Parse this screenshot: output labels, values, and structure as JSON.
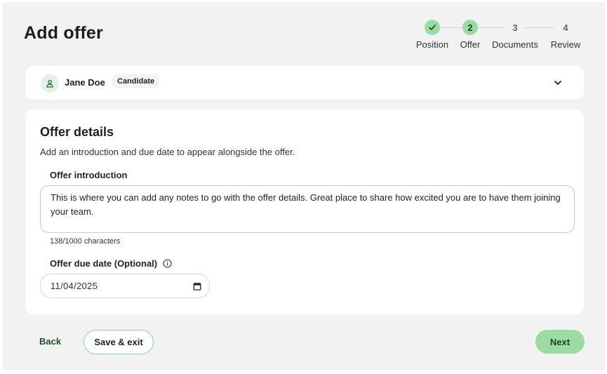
{
  "header": {
    "title": "Add offer"
  },
  "stepper": {
    "steps": [
      {
        "number": "1",
        "label": "Position",
        "state": "done"
      },
      {
        "number": "2",
        "label": "Offer",
        "state": "active"
      },
      {
        "number": "3",
        "label": "Documents",
        "state": "todo"
      },
      {
        "number": "4",
        "label": "Review",
        "state": "todo"
      }
    ]
  },
  "candidate": {
    "name": "Jane Doe",
    "badge": "Candidate",
    "icon": "person-icon",
    "expand_icon": "chevron-down-icon"
  },
  "offer_details": {
    "title": "Offer details",
    "description": "Add an introduction and due date to appear alongside the offer.",
    "intro_label": "Offer introduction",
    "intro_value": "This is where you can add any notes to go with the offer details. Great place to share how excited you are to have them joining your team.",
    "char_count": "138/1000 characters",
    "due_date_label": "Offer due date (Optional)",
    "due_date_value": "11/04/2025"
  },
  "footer": {
    "back_label": "Back",
    "save_label": "Save & exit",
    "next_label": "Next"
  },
  "colors": {
    "accent": "#9bdca4",
    "accent_dark": "#1f4d27"
  }
}
